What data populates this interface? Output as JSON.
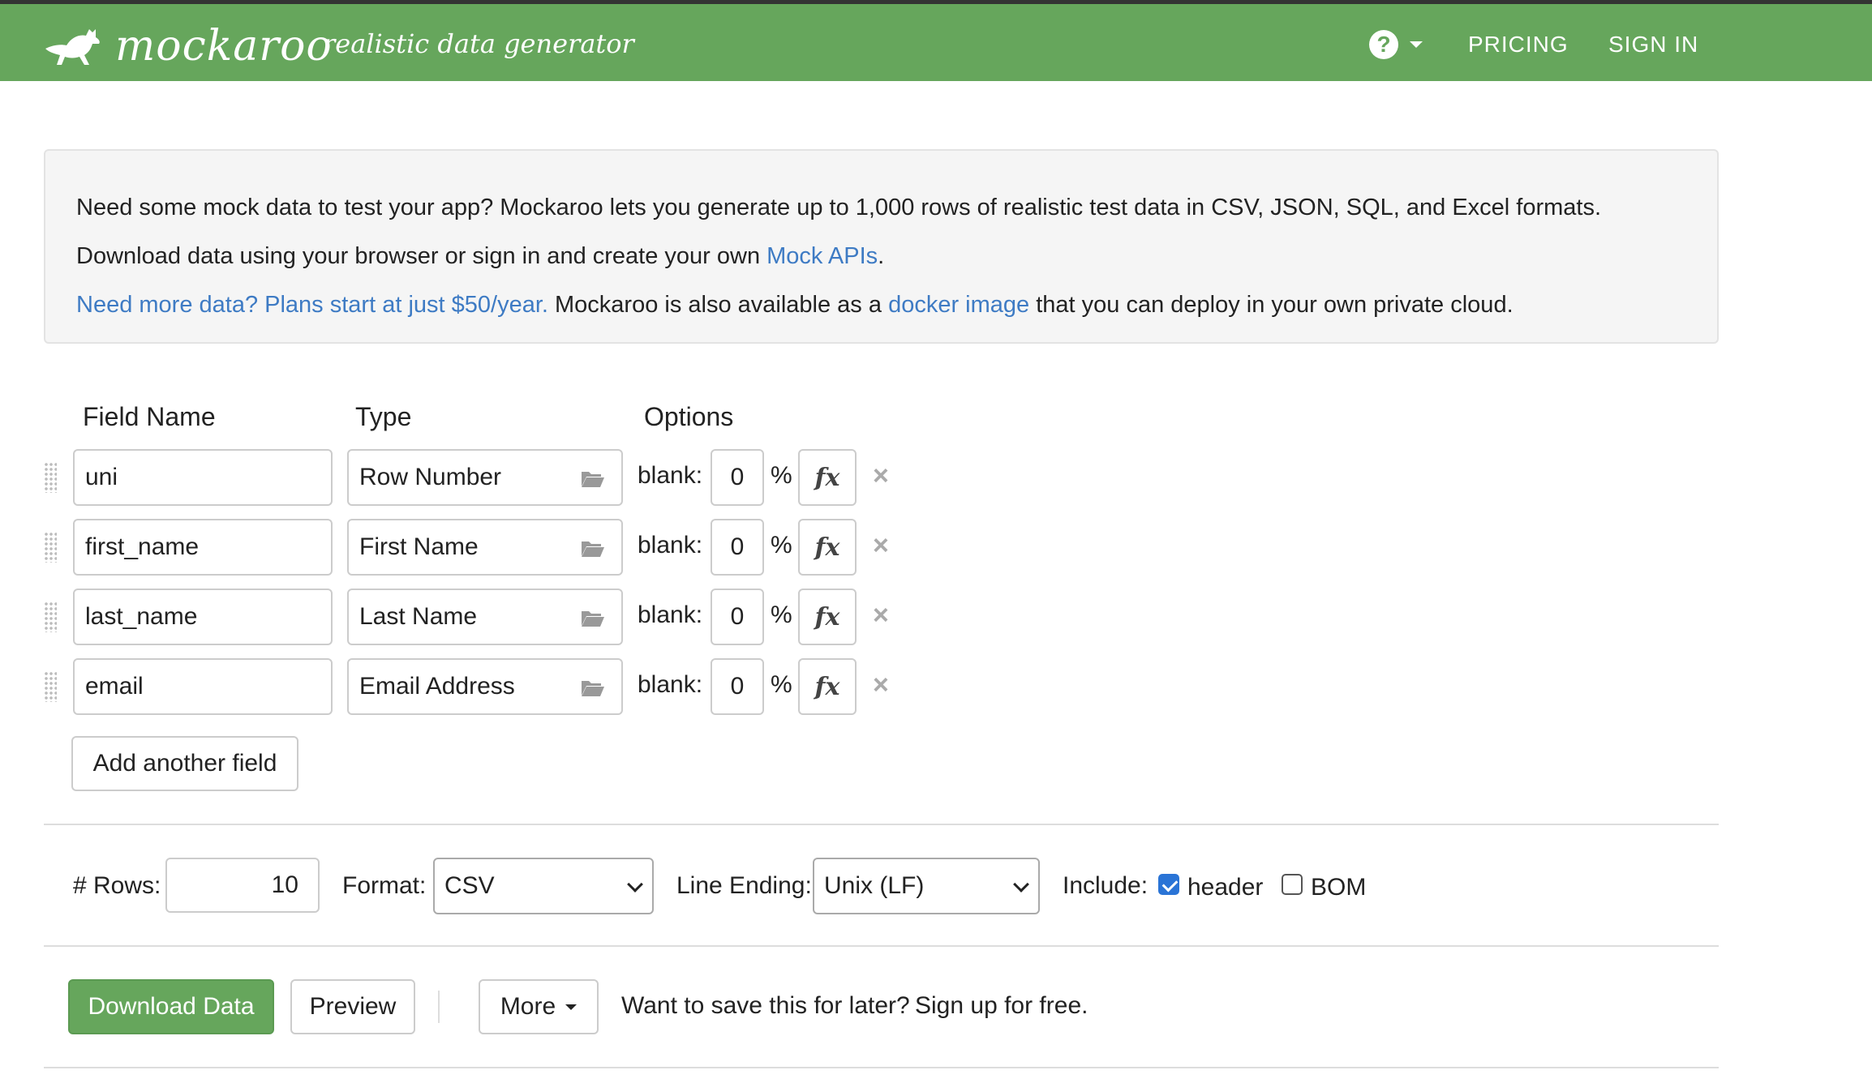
{
  "navbar": {
    "logo_text": "mockaroo",
    "tagline": "realistic data generator",
    "help_icon": "help-circle-icon",
    "pricing": "PRICING",
    "sign_in": "SIGN IN",
    "brand_color": "#66a65c"
  },
  "info": {
    "line1": "Need some mock data to test your app? Mockaroo lets you generate up to 1,000 rows of realistic test data in CSV, JSON, SQL, and Excel formats.",
    "line2_pre": "Download data using your browser or sign in and create your own ",
    "line2_link": "Mock APIs",
    "line2_post": ".",
    "line3_link1": "Need more data? Plans start at just $50/year.",
    "line3_mid": " Mockaroo is also available as a ",
    "line3_link2": "docker image",
    "line3_post": " that you can deploy in your own private cloud."
  },
  "fields_header": {
    "field_name": "Field Name",
    "type": "Type",
    "options": "Options"
  },
  "fields": [
    {
      "name": "uni",
      "type": "Row Number",
      "blank_label": "blank:",
      "blank": "0",
      "pct": "%",
      "fx": "fx"
    },
    {
      "name": "first_name",
      "type": "First Name",
      "blank_label": "blank:",
      "blank": "0",
      "pct": "%",
      "fx": "fx"
    },
    {
      "name": "last_name",
      "type": "Last Name",
      "blank_label": "blank:",
      "blank": "0",
      "pct": "%",
      "fx": "fx"
    },
    {
      "name": "email",
      "type": "Email Address",
      "blank_label": "blank:",
      "blank": "0",
      "pct": "%",
      "fx": "fx"
    }
  ],
  "add_field": "Add another field",
  "settings": {
    "rows_label": "# Rows:",
    "rows_value": "10",
    "format_label": "Format:",
    "format_value": "CSV",
    "line_ending_label": "Line Ending:",
    "line_ending_value": "Unix (LF)",
    "include_label": "Include:",
    "header_label": "header",
    "header_checked": true,
    "bom_label": "BOM",
    "bom_checked": false
  },
  "actions": {
    "download": "Download Data",
    "preview": "Preview",
    "more": "More",
    "save_prompt": "Want to save this for later?",
    "signup_link": "Sign up for free."
  }
}
